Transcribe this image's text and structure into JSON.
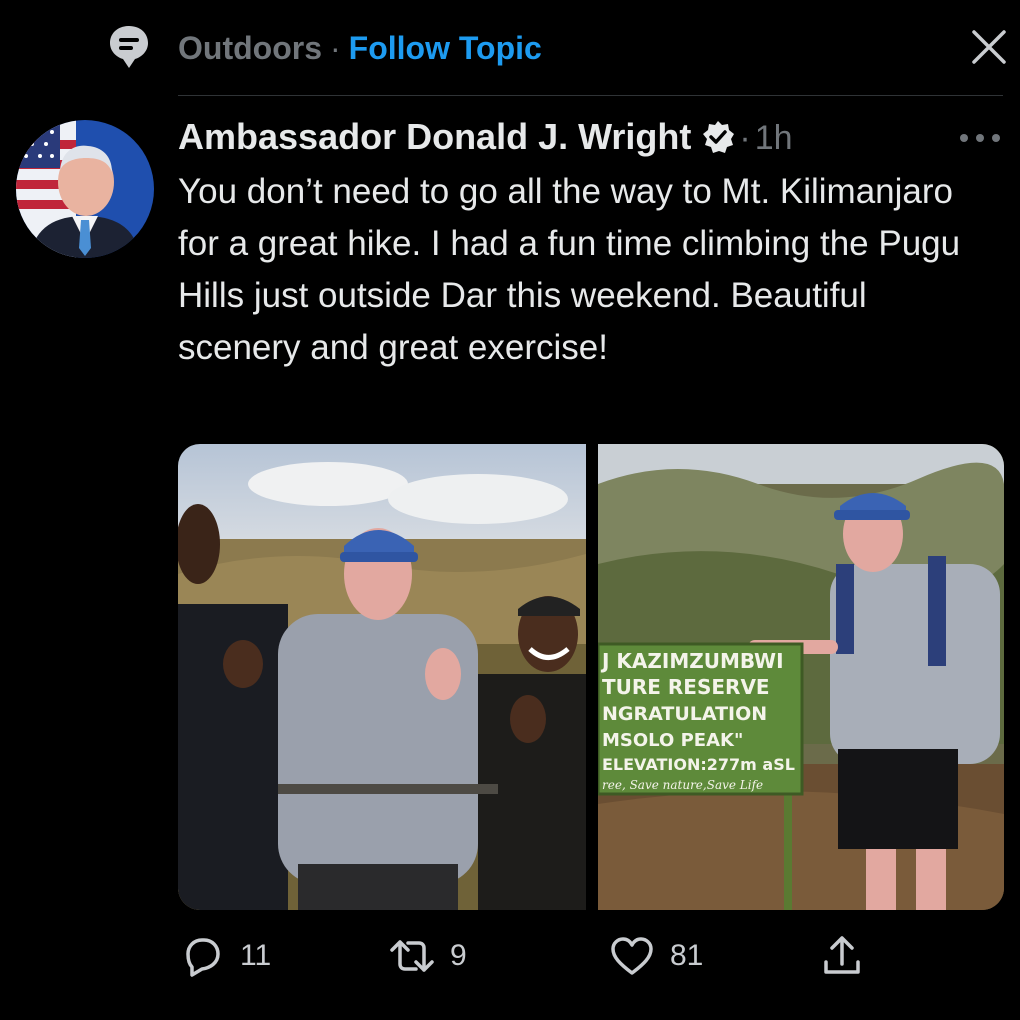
{
  "topic": {
    "icon": "topic-pin-icon",
    "name": "Outdoors",
    "separator": "·",
    "follow_label": "Follow Topic",
    "close_icon": "close-icon"
  },
  "tweet": {
    "author": "Ambassador Donald J. Wright",
    "verified": true,
    "time_separator": "·",
    "time": "1h",
    "more_icon": "more-icon",
    "text": "You don’t need to go all the way to Mt. Kilimanjaro for a great hike. I had a fun time climbing the Pugu Hills just outside Dar this weekend. Beautiful scenery and great exercise!",
    "sign_text": {
      "line1": "J KAZIMZUMBWI",
      "line2": "TURE RESERVE",
      "line3": "NGRATULATION",
      "line4": "MSOLO PEAK\"",
      "line5": "ELEVATION:277m aSL",
      "line6": "ree, Save nature,Save Life"
    }
  },
  "actions": {
    "reply_count": "11",
    "retweet_count": "9",
    "like_count": "81"
  },
  "colors": {
    "background": "#000000",
    "text": "#e7e9ea",
    "muted": "#71767b",
    "accent": "#1d9bf0"
  }
}
